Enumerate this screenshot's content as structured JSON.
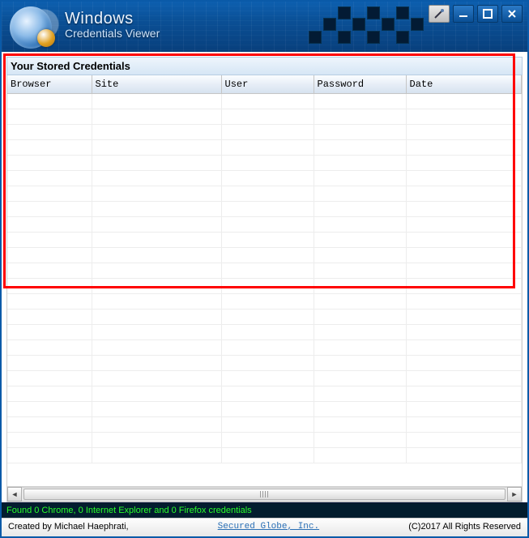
{
  "app": {
    "title_line1": "Windows",
    "title_line2": "Credentials Viewer"
  },
  "section": {
    "heading": "Your Stored Credentials"
  },
  "columns": {
    "browser": "Browser",
    "site": "Site",
    "user": "User",
    "password": "Password",
    "date": "Date"
  },
  "rows": [],
  "status": {
    "text": "Found 0 Chrome, 0 Internet Explorer and 0 Firefox credentials"
  },
  "footer": {
    "created_by": "Created by Michael Haephrati,",
    "link_text": "Secured Globe, Inc.",
    "copyright": "(C)2017 All Rights Reserved"
  },
  "colors": {
    "highlight_border": "#ff0000",
    "status_bg": "#031d2e",
    "status_fg": "#29ff29",
    "titlebar_start": "#0d5faf",
    "titlebar_end": "#083f7c"
  }
}
